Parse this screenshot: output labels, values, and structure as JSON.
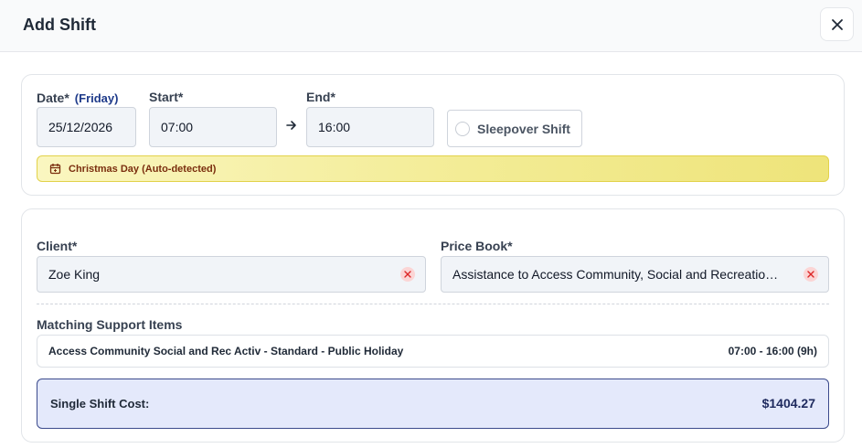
{
  "header": {
    "title": "Add Shift"
  },
  "date": {
    "label": "Date*",
    "weekday": "(Friday)",
    "value": "25/12/2026"
  },
  "start": {
    "label": "Start*",
    "value": "07:00"
  },
  "end": {
    "label": "End*",
    "value": "16:00"
  },
  "sleepover": {
    "label": "Sleepover Shift",
    "checked": false
  },
  "holiday": {
    "text": "Christmas Day (Auto-detected)"
  },
  "client": {
    "label": "Client*",
    "value": "Zoe King"
  },
  "price_book": {
    "label": "Price Book*",
    "value": "Assistance to Access Community, Social and Recreatio…"
  },
  "support": {
    "label": "Matching Support Items",
    "items": [
      {
        "name": "Access Community Social and Rec Activ - Standard - Public Holiday",
        "time": "07:00 - 16:00 (9h)"
      }
    ]
  },
  "cost": {
    "label": "Single Shift Cost:",
    "value": "$1404.27"
  },
  "colors": {
    "accent": "#1e3a8a",
    "holiday_bg": "#f3ec95",
    "cost_bg": "#e4e9fb",
    "clear_bg": "#fbd5d5",
    "clear_x": "#dc2626"
  }
}
